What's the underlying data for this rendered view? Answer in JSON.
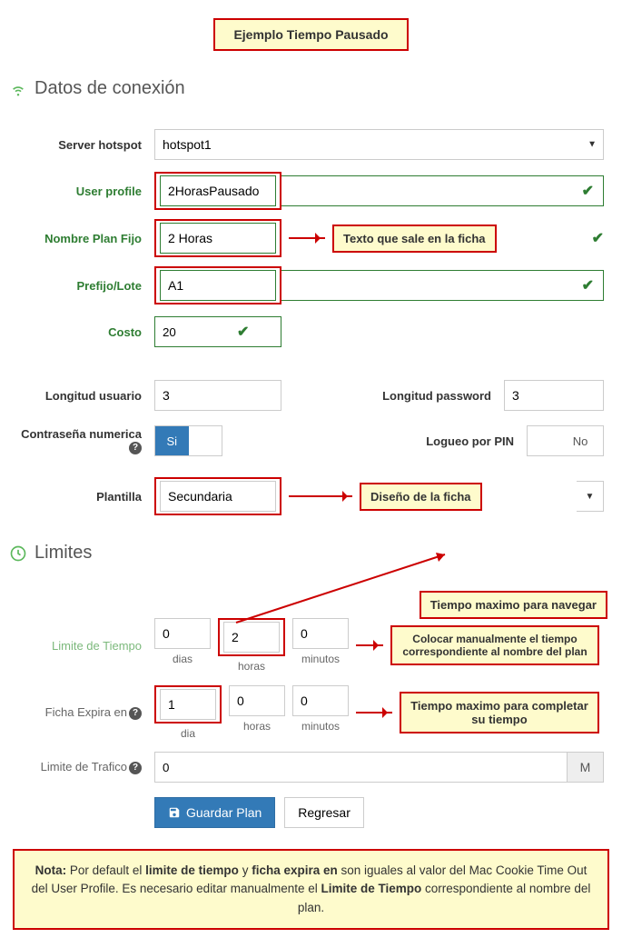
{
  "title_callout": "Ejemplo Tiempo Pausado",
  "section_conn": "Datos de conexión",
  "labels": {
    "server_hotspot": "Server hotspot",
    "user_profile": "User profile",
    "nombre_plan": "Nombre Plan Fijo",
    "prefijo": "Prefijo/Lote",
    "costo": "Costo",
    "long_usuario": "Longitud usuario",
    "long_pass": "Longitud password",
    "contrasena_num": "Contraseña numerica",
    "logueo_pin": "Logueo por PIN",
    "plantilla": "Plantilla",
    "limite_tiempo": "Limite de Tiempo",
    "ficha_expira": "Ficha Expira en",
    "limite_trafico": "Limite de Trafico"
  },
  "values": {
    "server_hotspot": "hotspot1",
    "user_profile": "2HorasPausado",
    "nombre_plan": "2 Horas",
    "prefijo": "A1",
    "costo": "20",
    "long_usuario": "3",
    "long_pass": "3",
    "plantilla": "Secundaria",
    "limite_trafico": "0",
    "limite_trafico_unit": "M",
    "toggle_si": "Si",
    "toggle_no": "No"
  },
  "time_limit": {
    "dias": "0",
    "horas": "2",
    "minutos": "0",
    "u_dias": "dias",
    "u_horas": "horas",
    "u_minutos": "minutos"
  },
  "expira": {
    "dia": "1",
    "horas": "0",
    "minutos": "0",
    "u_dia": "dia",
    "u_horas": "horas",
    "u_minutos": "minutos"
  },
  "callouts": {
    "texto_ficha": "Texto que sale en la ficha",
    "diseno": "Diseño de la ficha",
    "tiempo_nav": "Tiempo maximo para navegar",
    "colocar": "Colocar manualmente el tiempo correspondiente al nombre del plan",
    "completar": "Tiempo maximo para completar su tiempo"
  },
  "section_limites": "Limites",
  "buttons": {
    "guardar": "Guardar Plan",
    "regresar": "Regresar"
  },
  "note_html": {
    "prefix": "Nota:",
    "t1": " Por default el ",
    "b1": "limite de tiempo",
    "t2": " y ",
    "b2": "ficha expira en",
    "t3": " son iguales al valor del Mac Cookie Time Out del User Profile. Es necesario editar manualmente el ",
    "b3": "Limite de Tiempo",
    "t4": " correspondiente al nombre del plan."
  }
}
